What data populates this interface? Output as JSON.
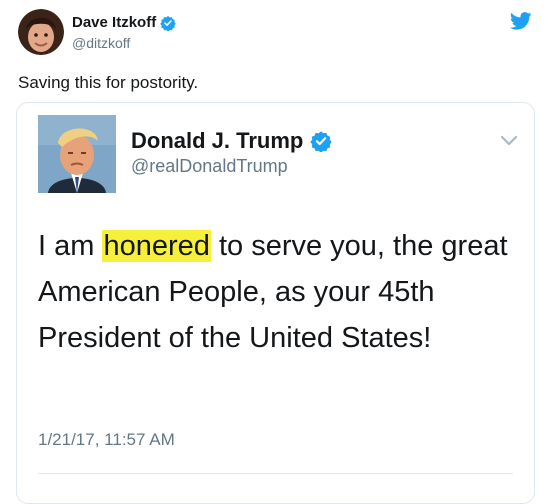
{
  "outer_tweet": {
    "author_name": "Dave Itzkoff",
    "author_handle": "@ditzkoff",
    "text": "Saving this for postority.",
    "verified_icon": "verified-badge-icon",
    "brand_icon": "twitter-bird-icon"
  },
  "quoted_tweet": {
    "author_name": "Donald J. Trump",
    "author_handle": "@realDonaldTrump",
    "text_before": "I am ",
    "text_highlight": "honered",
    "text_after": " to serve you, the great American People, as your 45th President of the United States!",
    "timestamp": "1/21/17, 11:57 AM",
    "menu_icon": "chevron-down-icon"
  },
  "colors": {
    "brand_blue": "#1da1f2",
    "highlight_yellow": "#f6f03a",
    "muted_text": "#657786",
    "primary_text": "#14171a",
    "border": "#e1e8ed"
  }
}
